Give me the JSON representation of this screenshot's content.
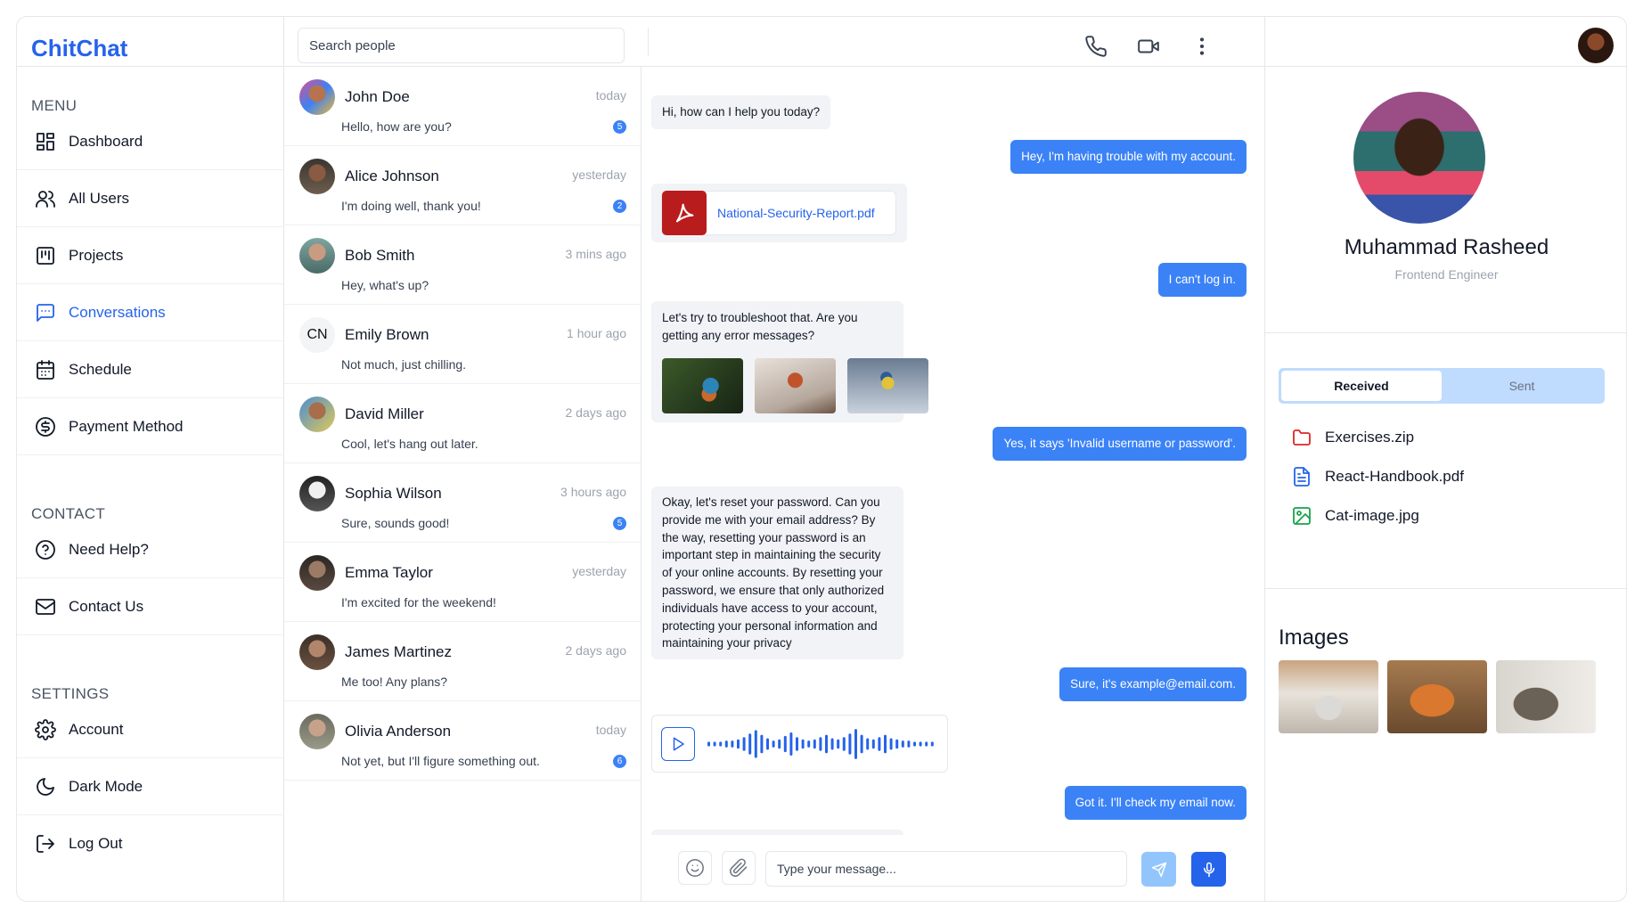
{
  "app": {
    "name": "ChitChat"
  },
  "sidebar": {
    "sections": [
      {
        "title": "MENU",
        "items": [
          {
            "label": "Dashboard",
            "icon": "dashboard-icon"
          },
          {
            "label": "All Users",
            "icon": "users-icon"
          },
          {
            "label": "Projects",
            "icon": "projects-icon"
          },
          {
            "label": "Conversations",
            "icon": "chat-icon",
            "active": true
          },
          {
            "label": "Schedule",
            "icon": "calendar-icon"
          },
          {
            "label": "Payment Method",
            "icon": "dollar-icon"
          }
        ]
      },
      {
        "title": "CONTACT",
        "items": [
          {
            "label": "Need Help?",
            "icon": "help-icon"
          },
          {
            "label": "Contact Us",
            "icon": "mail-icon"
          }
        ]
      },
      {
        "title": "SETTINGS",
        "items": [
          {
            "label": "Account",
            "icon": "gear-icon"
          },
          {
            "label": "Dark Mode",
            "icon": "moon-icon"
          },
          {
            "label": "Log Out",
            "icon": "logout-icon"
          }
        ]
      }
    ]
  },
  "search": {
    "placeholder": "Search people"
  },
  "contacts": [
    {
      "name": "John Doe",
      "time": "today",
      "message": "Hello, how are you?",
      "badge": "5"
    },
    {
      "name": "Alice Johnson",
      "time": "yesterday",
      "message": "I'm doing well, thank you!",
      "badge": "2"
    },
    {
      "name": "Bob Smith",
      "time": "3 mins ago",
      "message": "Hey, what's up?",
      "badge": ""
    },
    {
      "name": "Emily Brown",
      "time": "1 hour ago",
      "message": "Not much, just chilling.",
      "badge": "",
      "initials": "CN"
    },
    {
      "name": "David Miller",
      "time": "2 days ago",
      "message": "Cool, let's hang out later.",
      "badge": ""
    },
    {
      "name": "Sophia Wilson",
      "time": "3 hours ago",
      "message": "Sure, sounds good!",
      "badge": "5"
    },
    {
      "name": "Emma Taylor",
      "time": "yesterday",
      "message": "I'm excited for the weekend!",
      "badge": ""
    },
    {
      "name": "James Martinez",
      "time": "2 days ago",
      "message": "Me too! Any plans?",
      "badge": ""
    },
    {
      "name": "Olivia Anderson",
      "time": "today",
      "message": "Not yet, but I'll figure something out.",
      "badge": "6"
    }
  ],
  "chat": {
    "messages": {
      "m1": "Hi, how can I help you today?",
      "m2": "Hey, I'm having trouble with my account.",
      "file": "National-Security-Report.pdf",
      "m3": "I can't log in.",
      "m4": "Let's try to troubleshoot that. Are you getting any error messages?",
      "m5": "Yes, it says 'Invalid username or password'.",
      "m6": "Okay, let's reset your password. Can you provide me with your email address? By the way, resetting your password is an important step in maintaining the security of your online accounts. By resetting your password, we ensure that only authorized individuals have access to your account, protecting your personal information and maintaining your privacy",
      "m7": "Sure, it's example@email.com.",
      "m8": "Got it. I'll check my email now."
    },
    "input_placeholder": "Type your message..."
  },
  "profile": {
    "name": "Muhammad Rasheed",
    "role": "Frontend Engineer",
    "tabs": [
      "Received",
      "Sent"
    ],
    "files": [
      {
        "name": "Exercises.zip",
        "icon": "folder-icon",
        "color": "#dc2626"
      },
      {
        "name": "React-Handbook.pdf",
        "icon": "document-icon",
        "color": "#2563eb"
      },
      {
        "name": "Cat-image.jpg",
        "icon": "image-icon",
        "color": "#16a34a"
      }
    ],
    "images_title": "Images"
  },
  "colors": {
    "accent": "#3b82f6",
    "brand": "#2563eb",
    "pdf": "#b91c1c"
  }
}
